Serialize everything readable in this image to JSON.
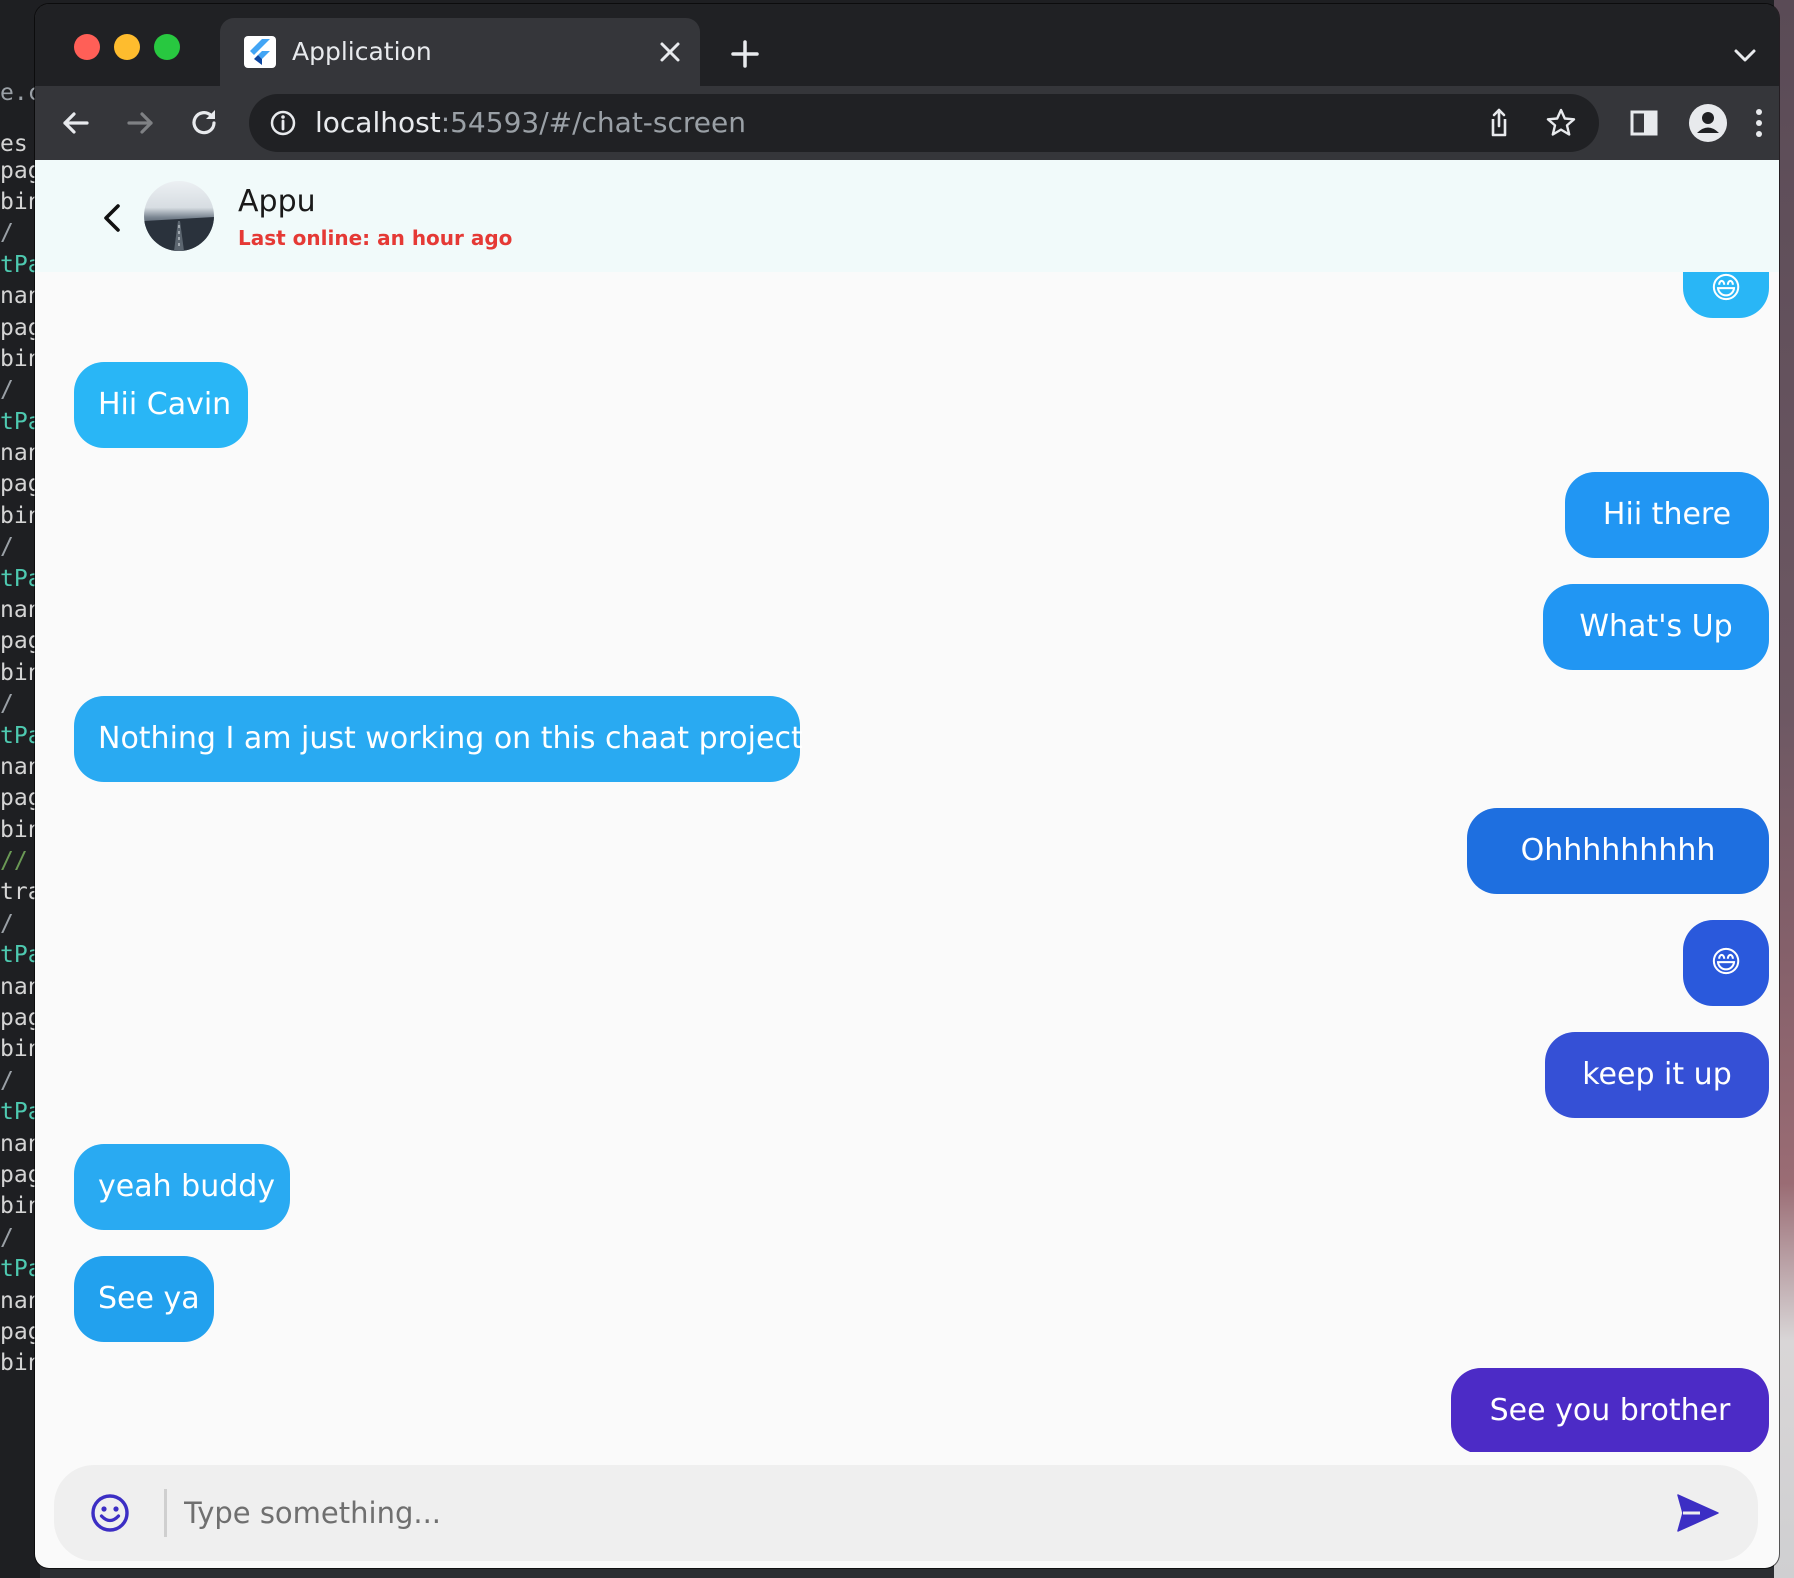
{
  "browser": {
    "tab_title": "Application",
    "url_host": "localhost",
    "url_rest": ":54593/#/chat-screen"
  },
  "background_editor": {
    "lines": [
      "e.c",
      "es",
      "pag",
      "bin",
      " /",
      "tPa",
      "nan",
      "pag",
      "bin",
      " /",
      "tPa",
      "nan",
      "pag",
      "bin",
      " /",
      "tPa",
      "nan",
      "pag",
      "bin",
      " /",
      "tPa",
      "nan",
      "pag",
      "bin",
      "//",
      "tra",
      " /",
      "tPa",
      "nan",
      "pag",
      "bin",
      " /",
      "tPa",
      "nan",
      "pag",
      "bin",
      " /",
      "tPa",
      "nan",
      "pag",
      "bin"
    ]
  },
  "chat": {
    "contact_name": "Appu",
    "last_online": "Last online: an hour ago",
    "messages": [
      {
        "text": "😄",
        "side": "right"
      },
      {
        "text": "Hii Cavin",
        "side": "left"
      },
      {
        "text": "Hii there",
        "side": "right"
      },
      {
        "text": "What's Up",
        "side": "right"
      },
      {
        "text": "Nothing I am just working on this chaat project",
        "side": "left"
      },
      {
        "text": "Ohhhhhhhhh",
        "side": "right"
      },
      {
        "text": "😄",
        "side": "right"
      },
      {
        "text": "keep it up",
        "side": "right"
      },
      {
        "text": "yeah buddy",
        "side": "left"
      },
      {
        "text": "See ya",
        "side": "left"
      },
      {
        "text": "See you brother",
        "side": "right"
      }
    ],
    "input": {
      "value": "",
      "placeholder": "Type something..."
    }
  },
  "colors": {
    "accent": "#3c2ec4",
    "status": "#e53935",
    "header_bg": "#f1fafa"
  },
  "icons": {
    "back": "arrow-back-icon",
    "emoji": "emoji-icon",
    "send": "send-icon"
  }
}
